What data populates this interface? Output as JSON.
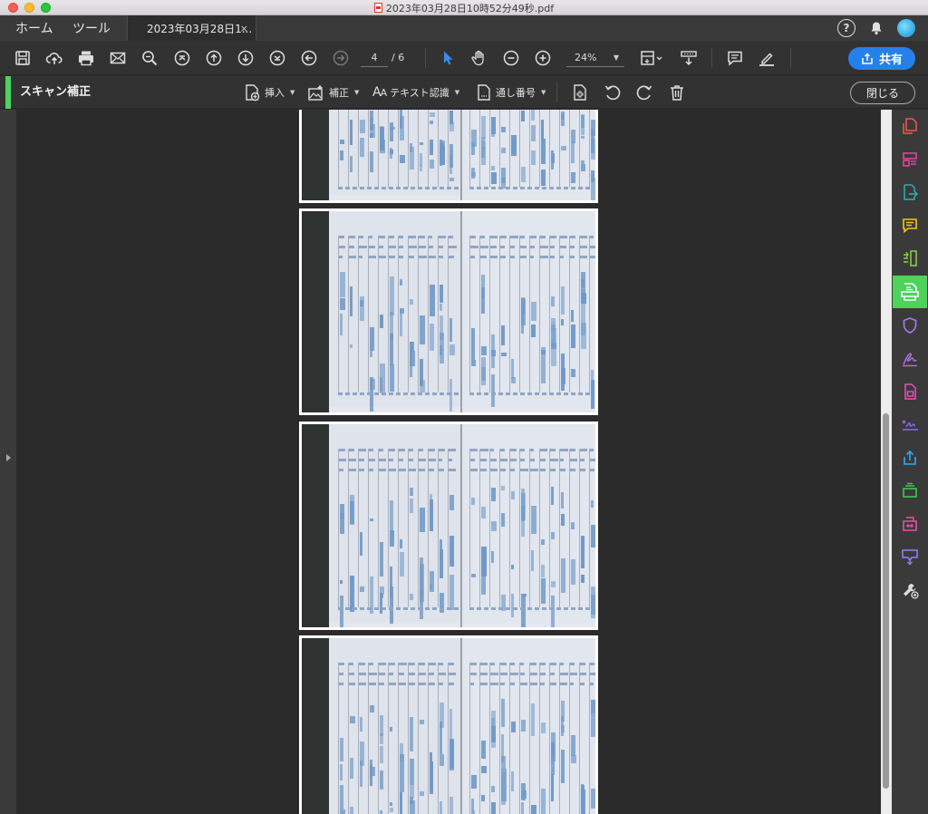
{
  "window": {
    "title": "2023年03月28日10時52分49秒.pdf"
  },
  "tabs": {
    "home": "ホーム",
    "tools": "ツール",
    "document": "2023年03月28日1...",
    "close": "×"
  },
  "header_icons": {
    "help": "?"
  },
  "toolbar": {
    "current_page": "4",
    "total_pages": "/ 6",
    "zoom": "24%",
    "share_label": "共有"
  },
  "scan_toolbar": {
    "title": "スキャン補正",
    "insert": "挿入",
    "enhance": "補正",
    "text_recognition": "テキスト認識",
    "bates_numbering": "通し番号",
    "close": "閉じる"
  },
  "icons": {
    "toolbar": [
      "save-icon",
      "cloud-upload-icon",
      "print-icon",
      "email-icon",
      "find-icon",
      "first-page-icon",
      "prev-page-icon",
      "next-page-icon",
      "last-page-icon",
      "back-icon",
      "forward-icon",
      "select-cursor-icon",
      "hand-icon",
      "zoom-out-icon",
      "zoom-in-icon",
      "fit-page-icon",
      "scroll-mode-icon",
      "comment-icon",
      "highlight-icon"
    ],
    "right_rail": [
      "create-pdf-icon",
      "organize-pages-icon",
      "export-pdf-icon",
      "comment-icon",
      "compare-icon",
      "scan-ocr-icon",
      "protect-icon",
      "fill-sign-icon",
      "edit-pdf-icon",
      "request-signature-icon",
      "share-icon",
      "stamp-icon",
      "combine-files-icon",
      "send-for-comments-icon",
      "more-tools-icon"
    ]
  },
  "colors": {
    "accent": "#2680eb",
    "scan_tool_active": "#4bd35b"
  }
}
